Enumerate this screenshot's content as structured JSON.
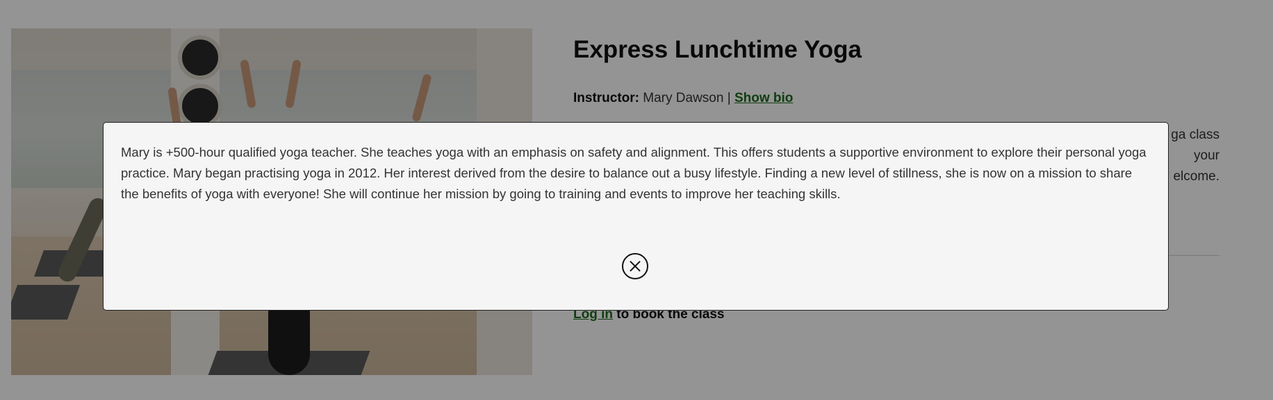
{
  "class": {
    "title": "Express Lunchtime Yoga",
    "instructor_label": "Instructor:",
    "instructor_name": "Mary Dawson",
    "separator": "|",
    "show_bio_link": "Show bio",
    "description": "ga class your elcome.",
    "login_link": "Log in",
    "login_suffix": "to book the class"
  },
  "bio_modal": {
    "text": "Mary is +500-hour qualified yoga teacher. She teaches yoga with an emphasis on safety and alignment. This offers students a supportive environment to explore their personal yoga practice. Mary began practising yoga in 2012. Her interest derived from the desire to balance out a busy lifestyle. Finding a new level of stillness, she is now on a mission to share the benefits of yoga with everyone! She will continue her mission by going to training and events to improve her teaching skills.",
    "close_icon": "close-circle-icon"
  },
  "colors": {
    "link": "#1c6b1c",
    "modal_background": "#f5f5f5",
    "overlay": "rgba(0,0,0,0.42)"
  }
}
